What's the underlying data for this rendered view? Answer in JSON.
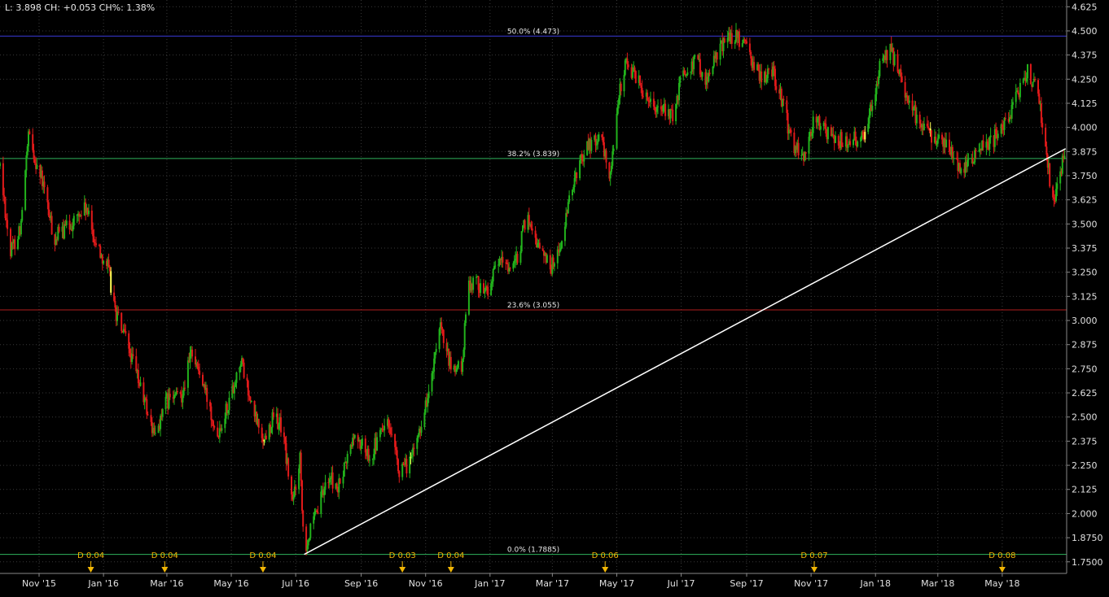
{
  "header": {
    "readout": "L: 3.898 CH: +0.053 CH%: 1.38%"
  },
  "colors": {
    "background": "#000000",
    "grid": "#3a3a3a",
    "axis_text": "#e0e0e0",
    "up_bar": "#22b21c",
    "down_bar": "#e01a1a",
    "highlight_bar": "#ffff55",
    "trendline": "#ffffff",
    "fib_50": "#3a3ad6",
    "fib_38": "#2fb25c",
    "fib_23": "#b01e1e",
    "fib_0": "#2fb25c",
    "dividend_marker": "#f2b705"
  },
  "chart_data": {
    "type": "candlestick",
    "title": "",
    "xlabel": "",
    "ylabel": "",
    "ylim": [
      1.69,
      4.66
    ],
    "xlim": [
      "2015-09-25",
      "2018-07-01"
    ],
    "y_ticks": [
      "4.625",
      "4.500",
      "4.375",
      "4.250",
      "4.125",
      "4.000",
      "3.875",
      "3.750",
      "3.625",
      "3.500",
      "3.375",
      "3.250",
      "3.125",
      "3.000",
      "2.875",
      "2.750",
      "2.625",
      "2.500",
      "2.375",
      "2.250",
      "2.125",
      "2.000",
      "1.8750",
      "1.7500"
    ],
    "x_ticks": [
      {
        "label": "Nov '15",
        "date": "2015-11-01"
      },
      {
        "label": "Jan '16",
        "date": "2016-01-01"
      },
      {
        "label": "Mar '16",
        "date": "2016-03-01"
      },
      {
        "label": "May '16",
        "date": "2016-05-01"
      },
      {
        "label": "Jul '16",
        "date": "2016-07-01"
      },
      {
        "label": "Sep '16",
        "date": "2016-09-01"
      },
      {
        "label": "Nov '16",
        "date": "2016-11-01"
      },
      {
        "label": "Jan '17",
        "date": "2017-01-01"
      },
      {
        "label": "Mar '17",
        "date": "2017-03-01"
      },
      {
        "label": "May '17",
        "date": "2017-05-01"
      },
      {
        "label": "Jul '17",
        "date": "2017-07-01"
      },
      {
        "label": "Sep '17",
        "date": "2017-09-01"
      },
      {
        "label": "Nov '17",
        "date": "2017-11-01"
      },
      {
        "label": "Jan '18",
        "date": "2018-01-01"
      },
      {
        "label": "Mar '18",
        "date": "2018-03-01"
      },
      {
        "label": "May '18",
        "date": "2018-05-01"
      }
    ],
    "price_path": [
      [
        "2015-09-25",
        3.8
      ],
      [
        "2015-10-05",
        3.35
      ],
      [
        "2015-10-15",
        3.5
      ],
      [
        "2015-10-22",
        3.95
      ],
      [
        "2015-11-05",
        3.7
      ],
      [
        "2015-11-15",
        3.42
      ],
      [
        "2015-12-01",
        3.5
      ],
      [
        "2015-12-15",
        3.58
      ],
      [
        "2015-12-25",
        3.4
      ],
      [
        "2016-01-05",
        3.28
      ],
      [
        "2016-01-12",
        3.05
      ],
      [
        "2016-01-25",
        2.85
      ],
      [
        "2016-02-08",
        2.6
      ],
      [
        "2016-02-18",
        2.4
      ],
      [
        "2016-03-01",
        2.58
      ],
      [
        "2016-03-15",
        2.62
      ],
      [
        "2016-03-25",
        2.85
      ],
      [
        "2016-04-05",
        2.65
      ],
      [
        "2016-04-18",
        2.42
      ],
      [
        "2016-05-01",
        2.62
      ],
      [
        "2016-05-10",
        2.8
      ],
      [
        "2016-05-20",
        2.55
      ],
      [
        "2016-06-01",
        2.38
      ],
      [
        "2016-06-10",
        2.5
      ],
      [
        "2016-06-18",
        2.45
      ],
      [
        "2016-06-28",
        2.05
      ],
      [
        "2016-07-05",
        2.3
      ],
      [
        "2016-07-09",
        1.82
      ],
      [
        "2016-07-20",
        1.98
      ],
      [
        "2016-08-01",
        2.2
      ],
      [
        "2016-08-10",
        2.12
      ],
      [
        "2016-08-25",
        2.4
      ],
      [
        "2016-09-10",
        2.3
      ],
      [
        "2016-09-25",
        2.48
      ],
      [
        "2016-10-08",
        2.2
      ],
      [
        "2016-10-20",
        2.3
      ],
      [
        "2016-11-05",
        2.65
      ],
      [
        "2016-11-15",
        2.95
      ],
      [
        "2016-11-25",
        2.75
      ],
      [
        "2016-12-05",
        2.75
      ],
      [
        "2016-12-12",
        3.2
      ],
      [
        "2016-12-20",
        3.2
      ],
      [
        "2016-12-28",
        3.15
      ],
      [
        "2017-01-10",
        3.3
      ],
      [
        "2017-01-25",
        3.28
      ],
      [
        "2017-02-05",
        3.55
      ],
      [
        "2017-02-15",
        3.4
      ],
      [
        "2017-02-28",
        3.28
      ],
      [
        "2017-03-10",
        3.4
      ],
      [
        "2017-03-20",
        3.7
      ],
      [
        "2017-04-01",
        3.9
      ],
      [
        "2017-04-15",
        3.95
      ],
      [
        "2017-04-25",
        3.75
      ],
      [
        "2017-05-01",
        4.1
      ],
      [
        "2017-05-10",
        4.35
      ],
      [
        "2017-05-25",
        4.2
      ],
      [
        "2017-06-10",
        4.1
      ],
      [
        "2017-06-25",
        4.05
      ],
      [
        "2017-07-01",
        4.28
      ],
      [
        "2017-07-15",
        4.35
      ],
      [
        "2017-07-25",
        4.25
      ],
      [
        "2017-08-10",
        4.45
      ],
      [
        "2017-08-20",
        4.48
      ],
      [
        "2017-09-01",
        4.4
      ],
      [
        "2017-09-15",
        4.25
      ],
      [
        "2017-09-25",
        4.3
      ],
      [
        "2017-10-05",
        4.12
      ],
      [
        "2017-10-15",
        3.9
      ],
      [
        "2017-10-25",
        3.85
      ],
      [
        "2017-11-05",
        4.05
      ],
      [
        "2017-11-20",
        3.95
      ],
      [
        "2017-12-05",
        3.92
      ],
      [
        "2017-12-20",
        3.95
      ],
      [
        "2018-01-05",
        4.3
      ],
      [
        "2018-01-15",
        4.4
      ],
      [
        "2018-01-25",
        4.25
      ],
      [
        "2018-02-05",
        4.1
      ],
      [
        "2018-02-15",
        3.98
      ],
      [
        "2018-03-01",
        3.95
      ],
      [
        "2018-03-15",
        3.85
      ],
      [
        "2018-03-25",
        3.78
      ],
      [
        "2018-04-10",
        3.9
      ],
      [
        "2018-04-25",
        3.95
      ],
      [
        "2018-05-10",
        4.1
      ],
      [
        "2018-05-25",
        4.3
      ],
      [
        "2018-06-05",
        4.15
      ],
      [
        "2018-06-12",
        3.85
      ],
      [
        "2018-06-18",
        3.62
      ],
      [
        "2018-06-24",
        3.75
      ],
      [
        "2018-06-30",
        3.9
      ]
    ],
    "highlight_dates": [
      "2016-01-08",
      "2016-06-01",
      "2016-10-18",
      "2017-01-08",
      "2017-06-10",
      "2017-12-02",
      "2017-12-22",
      "2018-02-22"
    ],
    "fib_levels": [
      {
        "label": "50.0% (4.473)",
        "value": 4.473,
        "color_key": "fib_50"
      },
      {
        "label": "38.2% (3.839)",
        "value": 3.839,
        "color_key": "fib_38"
      },
      {
        "label": "23.6% (3.055)",
        "value": 3.055,
        "color_key": "fib_23"
      },
      {
        "label": "0.0% (1.7885)",
        "value": 1.7885,
        "color_key": "fib_0"
      }
    ],
    "trendline": [
      [
        "2016-07-09",
        1.7885
      ],
      [
        "2018-06-30",
        3.89
      ]
    ],
    "dividends": [
      {
        "label": "D 0.04",
        "date": "2015-12-20"
      },
      {
        "label": "D 0.04",
        "date": "2016-02-28"
      },
      {
        "label": "D 0.04",
        "date": "2016-05-31"
      },
      {
        "label": "D 0.03",
        "date": "2016-10-10"
      },
      {
        "label": "D 0.04",
        "date": "2016-11-25"
      },
      {
        "label": "D 0.06",
        "date": "2017-04-20"
      },
      {
        "label": "D 0.07",
        "date": "2017-11-04"
      },
      {
        "label": "D 0.08",
        "date": "2018-05-01"
      }
    ]
  }
}
